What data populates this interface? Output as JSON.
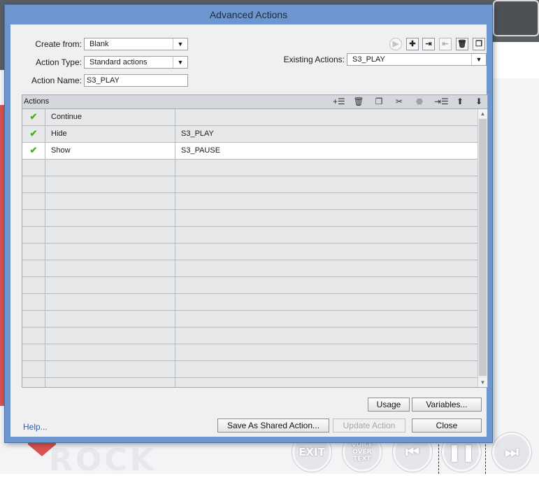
{
  "background": {
    "controls": {
      "exit": "EXIT",
      "voice": "VOICE OVER TEXT",
      "rew": "⏮",
      "pause": "❚❚",
      "ffw": "⏭"
    },
    "rock_text": "ROCK"
  },
  "dialog": {
    "title": "Advanced Actions",
    "create_from": {
      "label": "Create from:",
      "value": "Blank"
    },
    "action_type": {
      "label": "Action Type:",
      "value": "Standard actions"
    },
    "action_name": {
      "label": "Action Name:",
      "value": "S3_PLAY"
    },
    "existing_actions": {
      "label": "Existing Actions:",
      "value": "S3_PLAY"
    },
    "grid": {
      "header": "Actions",
      "rows": [
        {
          "checked": true,
          "action": "Continue",
          "target": ""
        },
        {
          "checked": true,
          "action": "Hide",
          "target": "S3_PLAY"
        },
        {
          "checked": true,
          "action": "Show",
          "target": "S3_PAUSE"
        },
        {
          "checked": false,
          "action": "",
          "target": ""
        },
        {
          "checked": false,
          "action": "",
          "target": ""
        },
        {
          "checked": false,
          "action": "",
          "target": ""
        },
        {
          "checked": false,
          "action": "",
          "target": ""
        },
        {
          "checked": false,
          "action": "",
          "target": ""
        },
        {
          "checked": false,
          "action": "",
          "target": ""
        },
        {
          "checked": false,
          "action": "",
          "target": ""
        },
        {
          "checked": false,
          "action": "",
          "target": ""
        },
        {
          "checked": false,
          "action": "",
          "target": ""
        },
        {
          "checked": false,
          "action": "",
          "target": ""
        },
        {
          "checked": false,
          "action": "",
          "target": ""
        },
        {
          "checked": false,
          "action": "",
          "target": ""
        },
        {
          "checked": false,
          "action": "",
          "target": ""
        },
        {
          "checked": false,
          "action": "",
          "target": ""
        }
      ],
      "selected_row": 2
    },
    "buttons": {
      "usage": "Usage",
      "variables": "Variables...",
      "save_shared": "Save As Shared Action...",
      "update_action": "Update Action",
      "close": "Close",
      "help": "Help..."
    },
    "colors": {
      "title_bar": "#6c96cd",
      "check": "#4caf23",
      "link": "#2d5ea8"
    }
  }
}
